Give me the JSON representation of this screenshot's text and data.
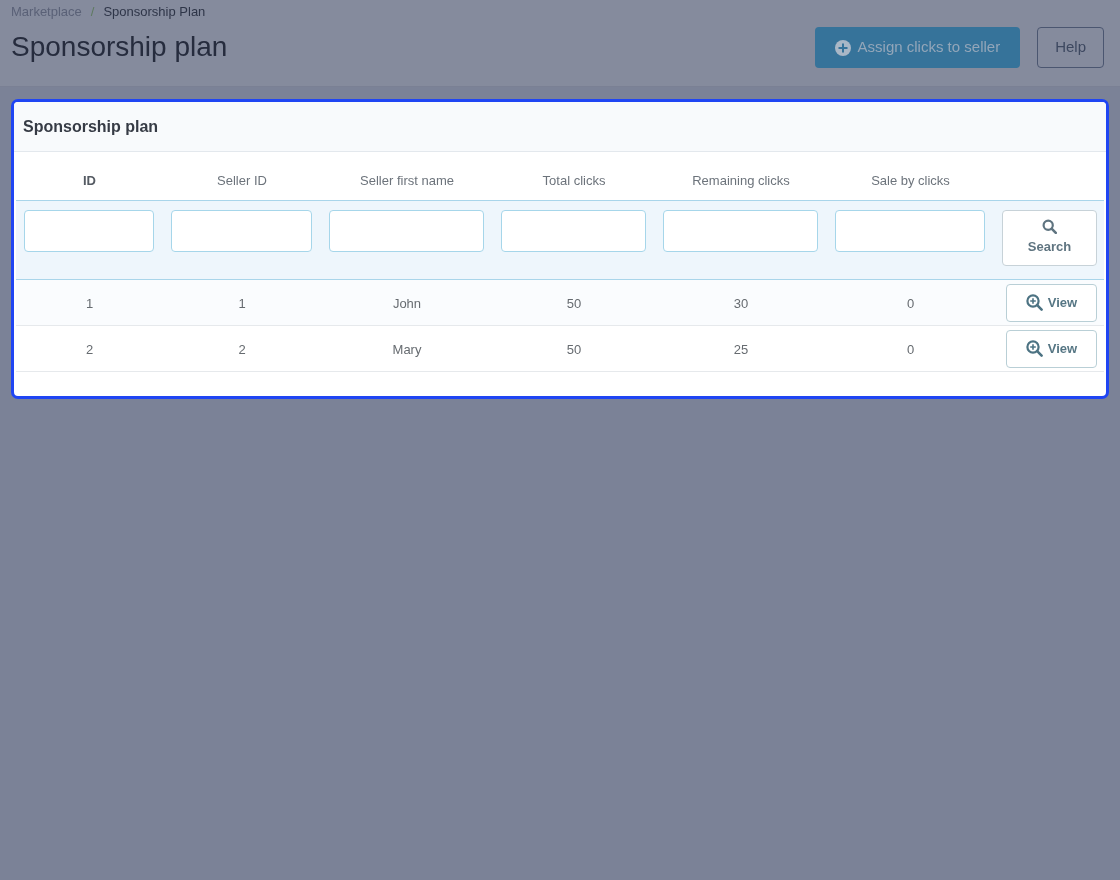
{
  "breadcrumb": [
    {
      "label": "Marketplace",
      "current": false
    },
    {
      "label": "Sponsorship Plan",
      "current": true
    }
  ],
  "breadcrumb_separator": "/",
  "page_title": "Sponsorship plan",
  "toolbar": [
    {
      "label": "Assign clicks to seller",
      "kind": "primary"
    },
    {
      "label": "Help",
      "kind": "outline"
    }
  ],
  "panel": {
    "title": "Sponsorship plan",
    "table": {
      "columns": [
        {
          "label": "ID",
          "active": true
        },
        {
          "label": "Seller ID",
          "active": false
        },
        {
          "label": "Seller first name",
          "active": false
        },
        {
          "label": "Total clicks",
          "active": false
        },
        {
          "label": "Remaining clicks",
          "active": false
        },
        {
          "label": "Sale by clicks",
          "active": false
        }
      ],
      "search_button": "Search",
      "rows": [
        {
          "cells": [
            "1",
            "1",
            "John",
            "50",
            "30",
            "0"
          ],
          "action": "View"
        },
        {
          "cells": [
            "2",
            "2",
            "Mary",
            "50",
            "25",
            "0"
          ],
          "action": "View"
        }
      ]
    }
  }
}
